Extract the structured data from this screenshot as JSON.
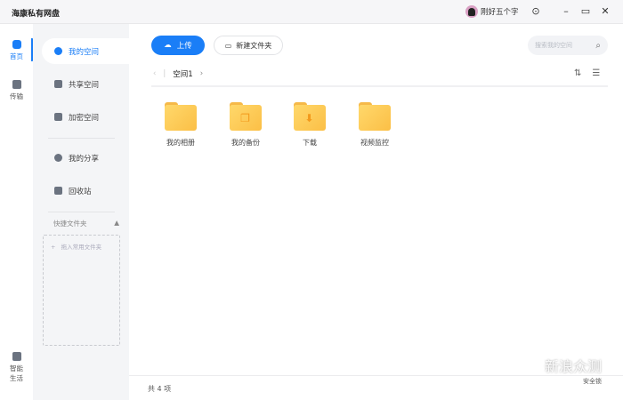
{
  "app": {
    "title": "海康私有网盘"
  },
  "titlebar": {
    "username": "刚好五个字"
  },
  "rail": [
    {
      "label": "首页",
      "active": true
    },
    {
      "label": "传输"
    },
    {
      "label": "智能生活"
    }
  ],
  "sidebar": {
    "items": [
      {
        "label": "我的空间",
        "active": true
      },
      {
        "label": "共享空间"
      },
      {
        "label": "加密空间"
      },
      {
        "label": "我的分享"
      },
      {
        "label": "回收站"
      }
    ],
    "quick_title": "快捷文件夹",
    "drop_hint": "拖入常用文件夹"
  },
  "toolbar": {
    "upload_label": "上传",
    "new_folder_label": "新建文件夹",
    "search_placeholder": "搜索我的空间"
  },
  "breadcrumb": {
    "current": "空间1"
  },
  "folders": [
    {
      "name": "我的相册",
      "glyph": ""
    },
    {
      "name": "我的备份",
      "glyph": "❐"
    },
    {
      "name": "下载",
      "glyph": "⬇"
    },
    {
      "name": "视频监控",
      "glyph": ""
    }
  ],
  "footer": {
    "count": "共 4 项"
  },
  "watermark": {
    "brand": "新浪众测",
    "sub": "安全锁"
  },
  "colors": {
    "accent": "#1a7ef7",
    "folder": "#fbbf46"
  }
}
